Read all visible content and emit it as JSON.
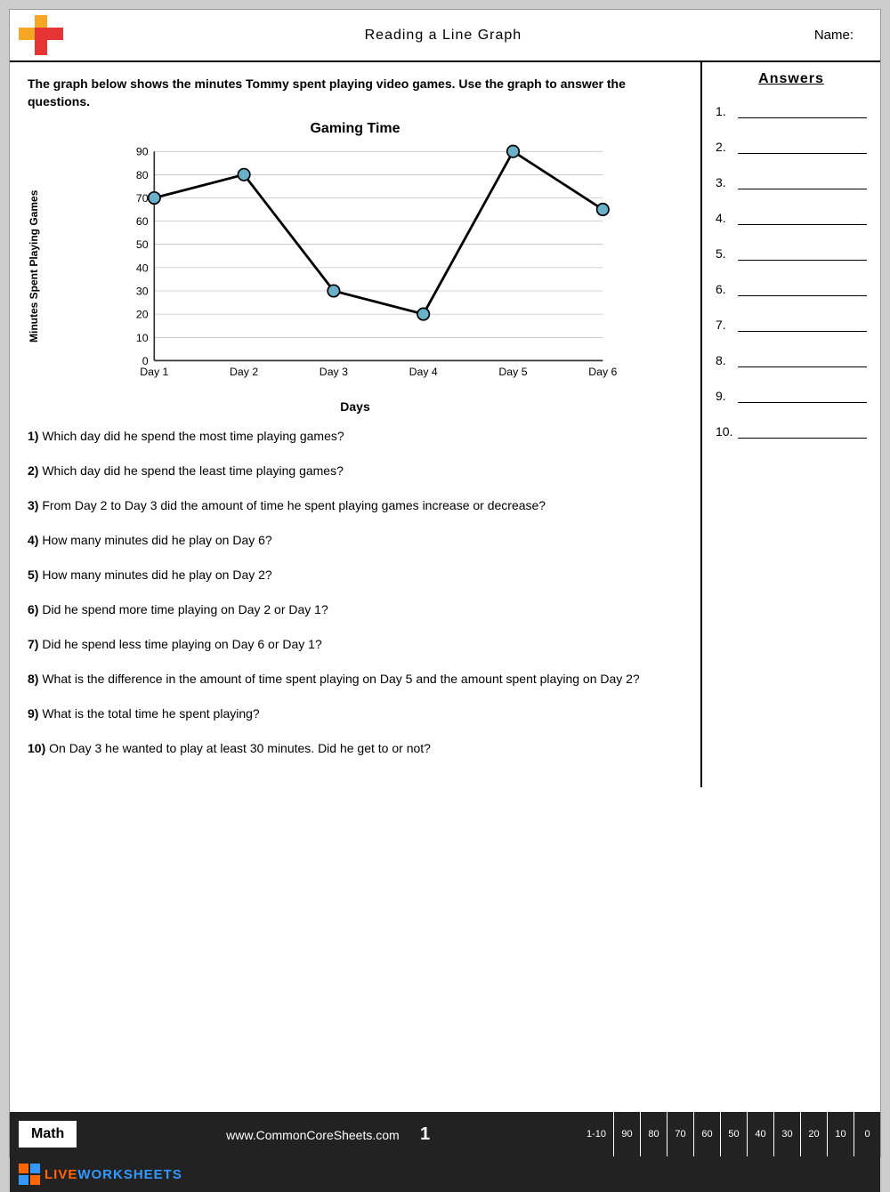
{
  "header": {
    "title": "Reading a Line Graph",
    "name_label": "Name:"
  },
  "intro": {
    "text": "The graph below shows the minutes Tommy spent playing video games. Use the graph to answer the questions."
  },
  "chart": {
    "title": "Gaming Time",
    "y_axis_label": "Minutes Spent Playing Games",
    "x_axis_label": "Days",
    "y_ticks": [
      0,
      10,
      20,
      30,
      40,
      50,
      60,
      70,
      80,
      90
    ],
    "x_labels": [
      "Day 1",
      "Day 2",
      "Day 3",
      "Day 4",
      "Day 5",
      "Day 6"
    ],
    "data_points": [
      {
        "day": "Day 1",
        "value": 70
      },
      {
        "day": "Day 2",
        "value": 80
      },
      {
        "day": "Day 3",
        "value": 30
      },
      {
        "day": "Day 4",
        "value": 20
      },
      {
        "day": "Day 5",
        "value": 90
      },
      {
        "day": "Day 6",
        "value": 65
      }
    ]
  },
  "questions": [
    {
      "num": "1)",
      "text": "Which day did he spend the most time playing games?"
    },
    {
      "num": "2)",
      "text": "Which day did he spend the least time playing games?"
    },
    {
      "num": "3)",
      "text": "From Day 2 to Day 3 did the amount of time he spent playing games increase or decrease?"
    },
    {
      "num": "4)",
      "text": "How many minutes did he play on Day 6?"
    },
    {
      "num": "5)",
      "text": "How many minutes did he play on Day 2?"
    },
    {
      "num": "6)",
      "text": "Did he spend more time playing on Day 2 or Day 1?"
    },
    {
      "num": "7)",
      "text": "Did he spend less time playing on Day 6 or Day 1?"
    },
    {
      "num": "8)",
      "text": "What is the difference in the amount of time spent playing on Day 5 and the amount spent playing on Day 2?"
    },
    {
      "num": "9)",
      "text": "What is the total time he spent playing?"
    },
    {
      "num": "10)",
      "text": "On Day 3 he wanted to play at least 30 minutes. Did he get to or not?"
    }
  ],
  "answers": {
    "title": "Answers",
    "items": [
      "1.",
      "2.",
      "3.",
      "4.",
      "5.",
      "6.",
      "7.",
      "8.",
      "9.",
      "10."
    ]
  },
  "footer": {
    "subject": "Math",
    "website": "www.CommonCoreSheets.com",
    "page_num": "1",
    "score_range": "1-10",
    "scores": [
      "90",
      "80",
      "70",
      "60",
      "50",
      "40",
      "30",
      "20",
      "10",
      "0"
    ]
  },
  "liveworksheets": {
    "text": "LIVEWORKSHEETS"
  }
}
